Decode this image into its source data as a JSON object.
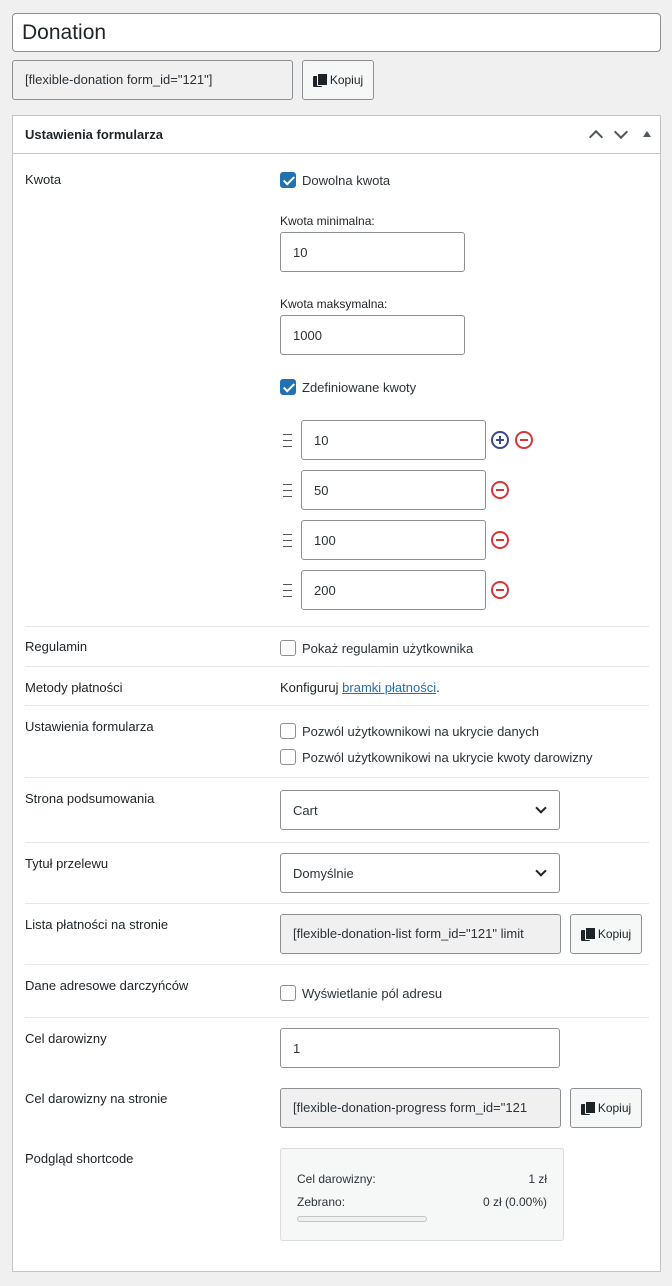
{
  "title": "Donation",
  "shortcode": {
    "value": "[flexible-donation form_id=\"121\"]",
    "copy_label": "Kopiuj"
  },
  "metabox": {
    "title": "Ustawienia formularza"
  },
  "amount": {
    "label": "Kwota",
    "free_amount": {
      "label": "Dowolna kwota",
      "checked": true
    },
    "min": {
      "label": "Kwota minimalna:",
      "value": "10"
    },
    "max": {
      "label": "Kwota maksymalna:",
      "value": "1000"
    },
    "predefined": {
      "label": "Zdefiniowane kwoty",
      "checked": true
    },
    "values": [
      "10",
      "50",
      "100",
      "200"
    ]
  },
  "terms": {
    "label": "Regulamin",
    "checkbox_label": "Pokaż regulamin użytkownika",
    "checked": false
  },
  "payment": {
    "label": "Metody płatności",
    "text_before": "Konfiguruj ",
    "link": "bramki płatności",
    "text_after": "."
  },
  "form_settings": {
    "label": "Ustawienia formularza",
    "hide_data": "Pozwól użytkownikowi na ukrycie danych",
    "hide_amount": "Pozwól użytkownikowi na ukrycie kwoty darowizny"
  },
  "summary_page": {
    "label": "Strona podsumowania",
    "selected": "Cart"
  },
  "transfer_title": {
    "label": "Tytuł przelewu",
    "selected": "Domyślnie"
  },
  "payment_list": {
    "label": "Lista płatności na stronie",
    "value": "[flexible-donation-list form_id=\"121\" limit",
    "copy_label": "Kopiuj"
  },
  "address": {
    "label": "Dane adresowe darczyńców",
    "checkbox_label": "Wyświetlanie pól adresu",
    "checked": false
  },
  "goal": {
    "label": "Cel darowizny",
    "value": "1"
  },
  "goal_page": {
    "label": "Cel darowizny na stronie",
    "value": "[flexible-donation-progress form_id=\"121",
    "copy_label": "Kopiuj"
  },
  "preview": {
    "label": "Podgląd shortcode",
    "goal_label": "Cel darowizny:",
    "goal_value": "1 zł",
    "collected_label": "Zebrano:",
    "collected_value": "0 zł (0.00%)",
    "progress_fraction": 0
  }
}
